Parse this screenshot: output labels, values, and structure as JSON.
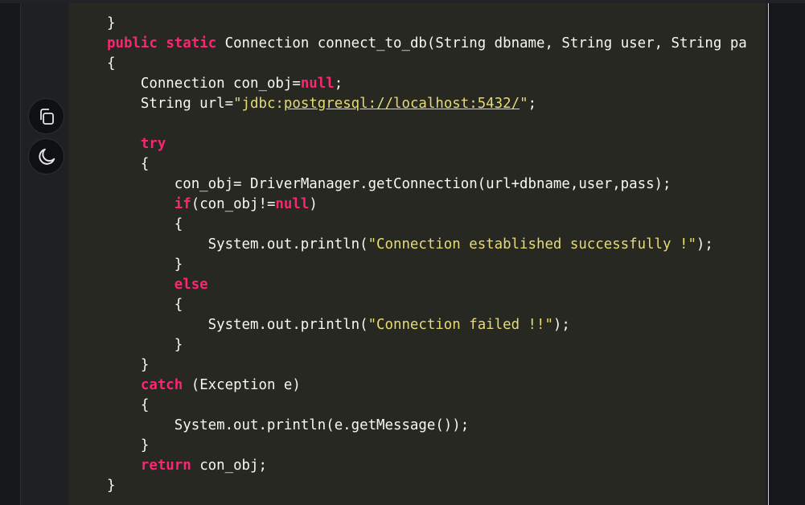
{
  "toolbar": {
    "copy_icon": "copy-icon",
    "theme_icon": "moon-icon"
  },
  "code": {
    "l01": {
      "c1": "}"
    },
    "l02": {
      "indent": "",
      "k1": "public",
      "k2": "static",
      "rest": " Connection connect_to_db(String dbname, String user, String pa"
    },
    "l03": {
      "c1": "{"
    },
    "l04": {
      "t1": "Connection con_obj=",
      "k1": "null",
      "t2": ";"
    },
    "l05": {
      "t1": "String url=",
      "q1": "\"",
      "s1": "jdbc:",
      "u1": "postgresql://localhost:5432/",
      "q2": "\"",
      "t2": ";"
    },
    "l07": {
      "k1": "try"
    },
    "l08": {
      "c1": "{"
    },
    "l09": {
      "t1": "con_obj= DriverManager.getConnection(url+dbname,user,pass);"
    },
    "l10": {
      "k1": "if",
      "t1": "(con_obj!=",
      "k2": "null",
      "t2": ")"
    },
    "l11": {
      "c1": "{"
    },
    "l12": {
      "t1": "System.out.println(",
      "s1": "\"Connection established successfully !\"",
      "t2": ");"
    },
    "l13": {
      "c1": "}"
    },
    "l14": {
      "k1": "else"
    },
    "l15": {
      "c1": "{"
    },
    "l16": {
      "t1": "System.out.println(",
      "s1": "\"Connection failed !!\"",
      "t2": ");"
    },
    "l17": {
      "c1": "}"
    },
    "l18": {
      "c1": "}"
    },
    "l19": {
      "k1": "catch",
      "t1": " (Exception e)"
    },
    "l20": {
      "c1": "{"
    },
    "l21": {
      "t1": "System.out.println(e.getMessage());"
    },
    "l22": {
      "c1": "}"
    },
    "l23": {
      "k1": "return",
      "t1": " con_obj;"
    },
    "l24": {
      "c1": "}"
    }
  },
  "colors": {
    "background": "#15171b",
    "code_background": "#272822",
    "text": "#f8f8f2",
    "keyword": "#f92672",
    "string": "#e6db74"
  }
}
